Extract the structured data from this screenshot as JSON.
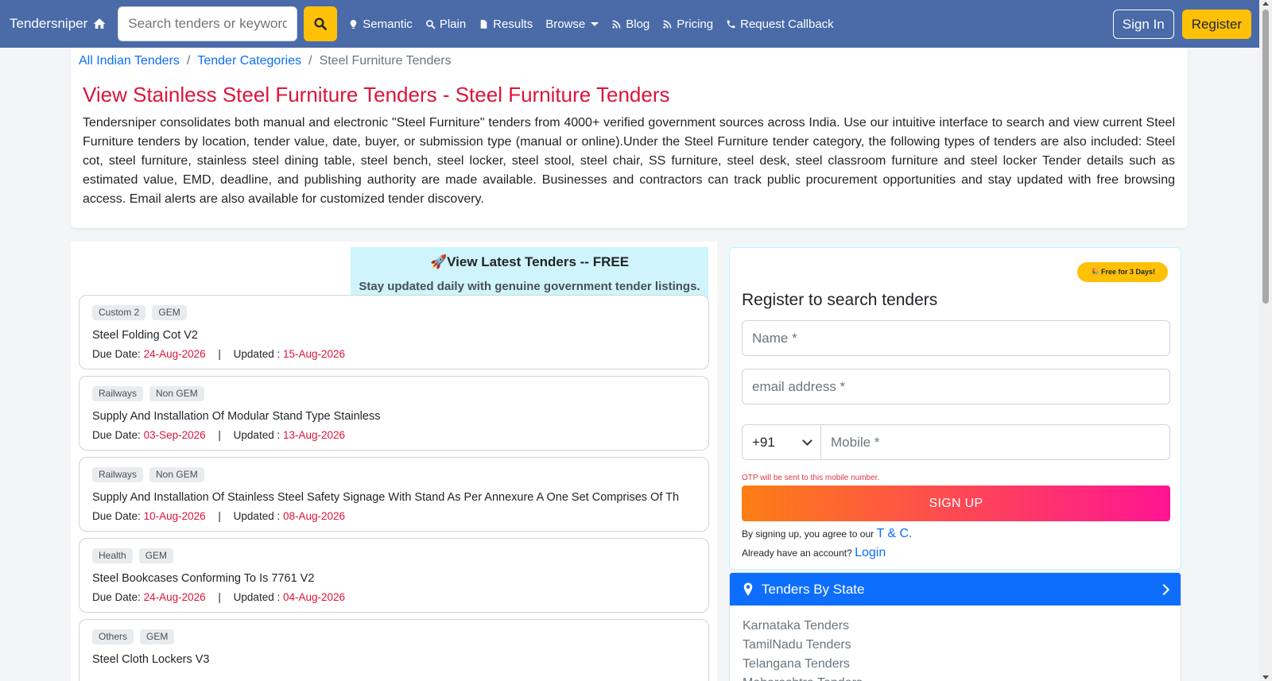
{
  "navbar": {
    "brand": "Tendersniper",
    "search_placeholder": "Search tenders or keywords",
    "links": [
      {
        "label": "Semantic",
        "icon": "lightbulb-icon"
      },
      {
        "label": "Plain",
        "icon": "search-icon"
      },
      {
        "label": "Results",
        "icon": "file-icon"
      },
      {
        "label": "Browse",
        "icon": "chevron-down-icon"
      },
      {
        "label": "Blog",
        "icon": "feed-icon"
      },
      {
        "label": "Pricing",
        "icon": "feed-icon"
      },
      {
        "label": "Request Callback",
        "icon": "phone-icon"
      }
    ],
    "signin_label": "Sign In",
    "register_label": "Register"
  },
  "breadcrumb": {
    "items": [
      "All Indian Tenders",
      "Tender Categories"
    ],
    "current": "Steel Furniture Tenders",
    "separator": "/"
  },
  "page": {
    "title": "View Stainless Steel Furniture Tenders - Steel Furniture Tenders",
    "intro": "Tendersniper consolidates both manual and electronic \"Steel Furniture\" tenders from 4000+ verified government sources across India. Use our intuitive interface to search and view current Steel Furniture tenders by location, tender value, date, buyer, or submission type (manual or online).Under the Steel Furniture tender category, the following types of tenders are also included: Steel cot, steel furniture, stainless steel dining table, steel bench, steel locker, steel stool, steel chair, SS furniture, steel desk, steel classroom furniture and steel locker Tender details such as estimated value, EMD, deadline, and publishing authority are made available. Businesses and contractors can track public procurement opportunities and stay updated with free browsing access. Email alerts are also available for customized tender discovery."
  },
  "promo": {
    "title": "🚀View Latest Tenders -- FREE",
    "subtitle": "Stay updated daily with genuine government tender listings."
  },
  "tenders": [
    {
      "tags": [
        "Custom 2",
        "GEM"
      ],
      "title": "Steel Folding Cot V2",
      "due_label": "Due Date:",
      "due": "24-Aug-2026",
      "updated_label": "Updated :",
      "updated": "15-Aug-2026"
    },
    {
      "tags": [
        "Railways",
        "Non GEM"
      ],
      "title": "Supply And Installation Of Modular Stand Type Stainless",
      "due_label": "Due Date:",
      "due": "03-Sep-2026",
      "updated_label": "Updated :",
      "updated": "13-Aug-2026"
    },
    {
      "tags": [
        "Railways",
        "Non GEM"
      ],
      "title": "Supply And Installation Of Stainless Steel Safety Signage With Stand As Per Annexure A One Set Comprises Of Th",
      "due_label": "Due Date:",
      "due": "10-Aug-2026",
      "updated_label": "Updated :",
      "updated": "08-Aug-2026"
    },
    {
      "tags": [
        "Health",
        "GEM"
      ],
      "title": "Steel Bookcases Conforming To Is 7761 V2",
      "due_label": "Due Date:",
      "due": "24-Aug-2026",
      "updated_label": "Updated :",
      "updated": "04-Aug-2026"
    },
    {
      "tags": [
        "Others",
        "GEM"
      ],
      "title": "Steel Cloth Lockers V3",
      "due_label": "",
      "due": "",
      "updated_label": "",
      "updated": ""
    }
  ],
  "register": {
    "badge": "🎉 Free for 3 Days!",
    "title": "Register to search tenders",
    "name_placeholder": "Name *",
    "email_placeholder": "email address *",
    "country_code": "+91",
    "mobile_placeholder": "Mobile *",
    "otp_note": "OTP will be sent to this mobile number.",
    "signup_label": "SIGN UP",
    "terms_text": "By signing up, you agree to our",
    "terms_link": "T & C.",
    "login_text": "Already have an account?",
    "login_link": "Login"
  },
  "states": {
    "header": "Tenders By State",
    "items": [
      "Karnataka Tenders",
      "TamilNadu Tenders",
      "Telangana Tenders",
      "Maharashtra Tenders"
    ]
  },
  "colors": {
    "navbar": "#4a6aa8",
    "accent_yellow": "#ffc107",
    "title_red": "#dc143c",
    "link_blue": "#0d6efd"
  }
}
